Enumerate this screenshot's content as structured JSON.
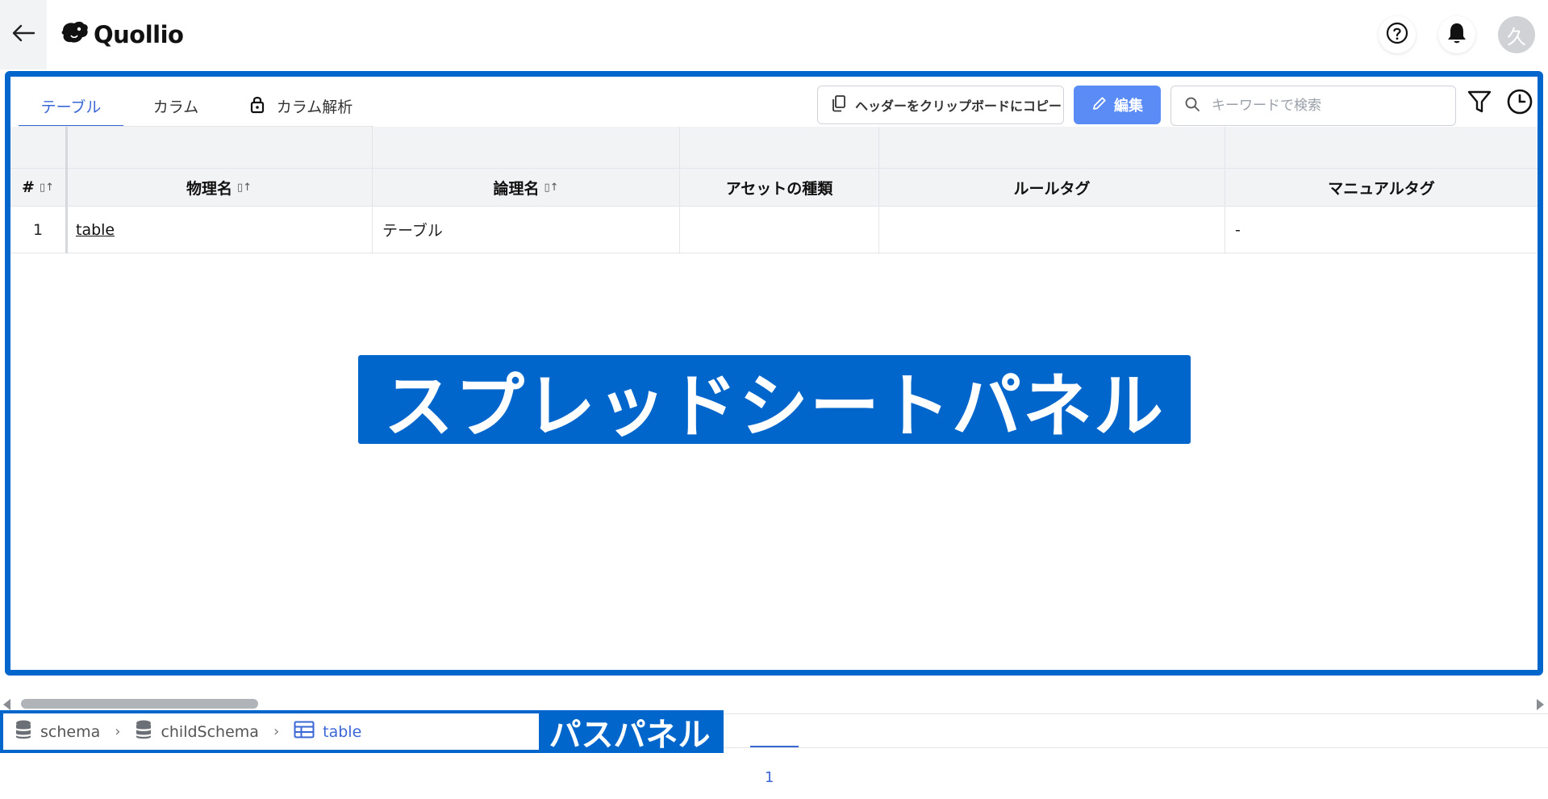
{
  "header": {
    "logo_text": "Quollio",
    "avatar_initial": "久",
    "icons": [
      "back-arrow-icon",
      "help-icon",
      "bell-icon"
    ]
  },
  "tabs": [
    {
      "label": "テーブル",
      "active": true
    },
    {
      "label": "カラム",
      "active": false
    },
    {
      "label": "カラム解析",
      "active": false,
      "locked": true
    }
  ],
  "toolbar": {
    "copy_label": "ヘッダーをクリップボードにコピー",
    "edit_label": "編集",
    "search_placeholder": "キーワードで検索"
  },
  "table": {
    "columns": [
      "#",
      "物理名",
      "論理名",
      "アセットの種類",
      "ルールタグ",
      "マニュアルタグ"
    ],
    "rows": [
      {
        "index": "1",
        "physical": "table",
        "logical": "テーブル",
        "asset_type": "",
        "rule_tag": "",
        "manual_tag": "-"
      }
    ]
  },
  "overlay_label": "スプレッドシートパネル",
  "path": {
    "crumbs": [
      {
        "label": "schema",
        "icon": "database-icon"
      },
      {
        "label": "childSchema",
        "icon": "database-icon"
      },
      {
        "label": "table",
        "icon": "table-icon"
      }
    ],
    "label": "パスパネル"
  },
  "pagination": {
    "current": "1"
  },
  "colors": {
    "accent": "#3a66d6",
    "annotation": "#0066cc",
    "edit_button": "#5b8cf5"
  }
}
